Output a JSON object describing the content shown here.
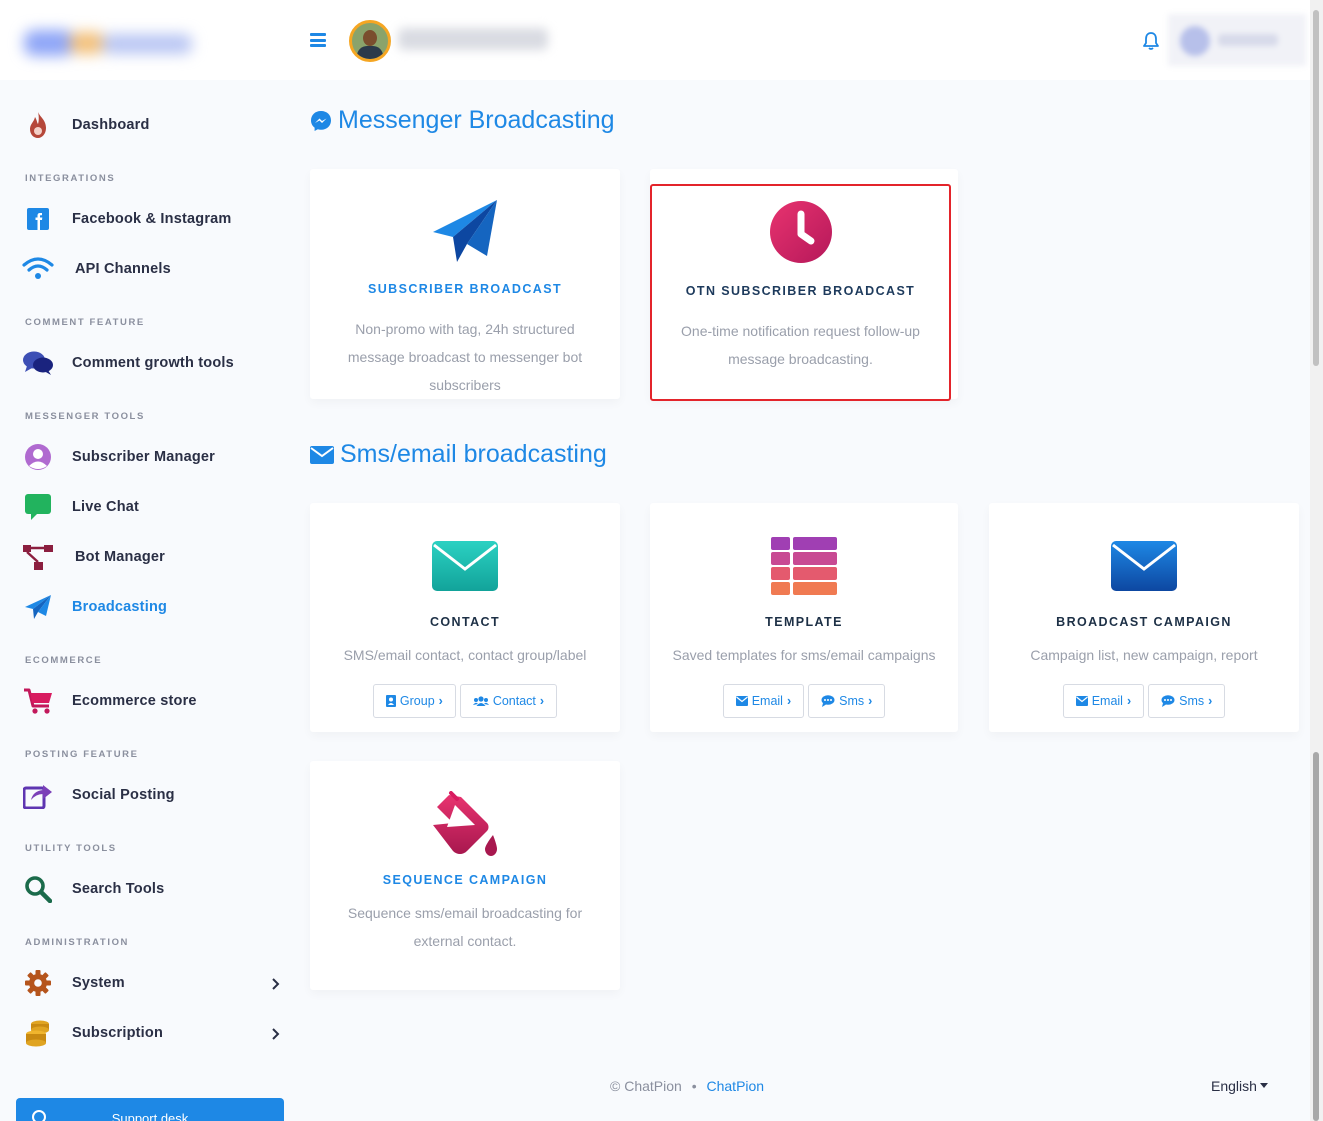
{
  "sidebar": {
    "items": [
      {
        "label": "Dashboard",
        "icon": "flame-icon"
      },
      {
        "label": "Facebook & Instagram",
        "icon": "facebook-icon"
      },
      {
        "label": "API Channels",
        "icon": "wifi-icon"
      },
      {
        "label": "Comment growth tools",
        "icon": "chat-bubbles-icon"
      },
      {
        "label": "Subscriber Manager",
        "icon": "user-circle-icon"
      },
      {
        "label": "Live Chat",
        "icon": "chat-icon"
      },
      {
        "label": "Bot Manager",
        "icon": "sitemap-icon"
      },
      {
        "label": "Broadcasting",
        "icon": "paper-plane-icon"
      },
      {
        "label": "Ecommerce store",
        "icon": "cart-icon"
      },
      {
        "label": "Social Posting",
        "icon": "share-icon"
      },
      {
        "label": "Search Tools",
        "icon": "search-icon"
      },
      {
        "label": "System",
        "icon": "gear-icon"
      },
      {
        "label": "Subscription",
        "icon": "coins-icon"
      }
    ],
    "sections": [
      "INTEGRATIONS",
      "COMMENT FEATURE",
      "MESSENGER TOOLS",
      "ECOMMERCE",
      "POSTING FEATURE",
      "UTILITY TOOLS",
      "ADMINISTRATION"
    ],
    "support_label": "Support desk"
  },
  "messenger": {
    "heading": "Messenger Broadcasting",
    "cards": [
      {
        "title": "SUBSCRIBER BROADCAST",
        "desc": "Non-promo with tag, 24h structured message broadcast to messenger bot subscribers"
      },
      {
        "title": "OTN SUBSCRIBER BROADCAST",
        "desc": "One-time notification request follow-up message broadcasting."
      }
    ]
  },
  "sms": {
    "heading": "Sms/email broadcasting",
    "cards": [
      {
        "title": "CONTACT",
        "desc": "SMS/email contact, contact group/label",
        "buttons": [
          "Group",
          "Contact"
        ]
      },
      {
        "title": "TEMPLATE",
        "desc": "Saved templates for sms/email campaigns",
        "buttons": [
          "Email",
          "Sms"
        ]
      },
      {
        "title": "BROADCAST CAMPAIGN",
        "desc": "Campaign list, new campaign, report",
        "buttons": [
          "Email",
          "Sms"
        ]
      },
      {
        "title": "SEQUENCE CAMPAIGN",
        "desc": "Sequence sms/email broadcasting for external contact."
      }
    ]
  },
  "footer": {
    "copyright": "© ChatPion",
    "separator": "•",
    "link": "ChatPion",
    "language": "English"
  },
  "colors": {
    "accent": "#1e88e5",
    "highlight": "#e3242b"
  }
}
